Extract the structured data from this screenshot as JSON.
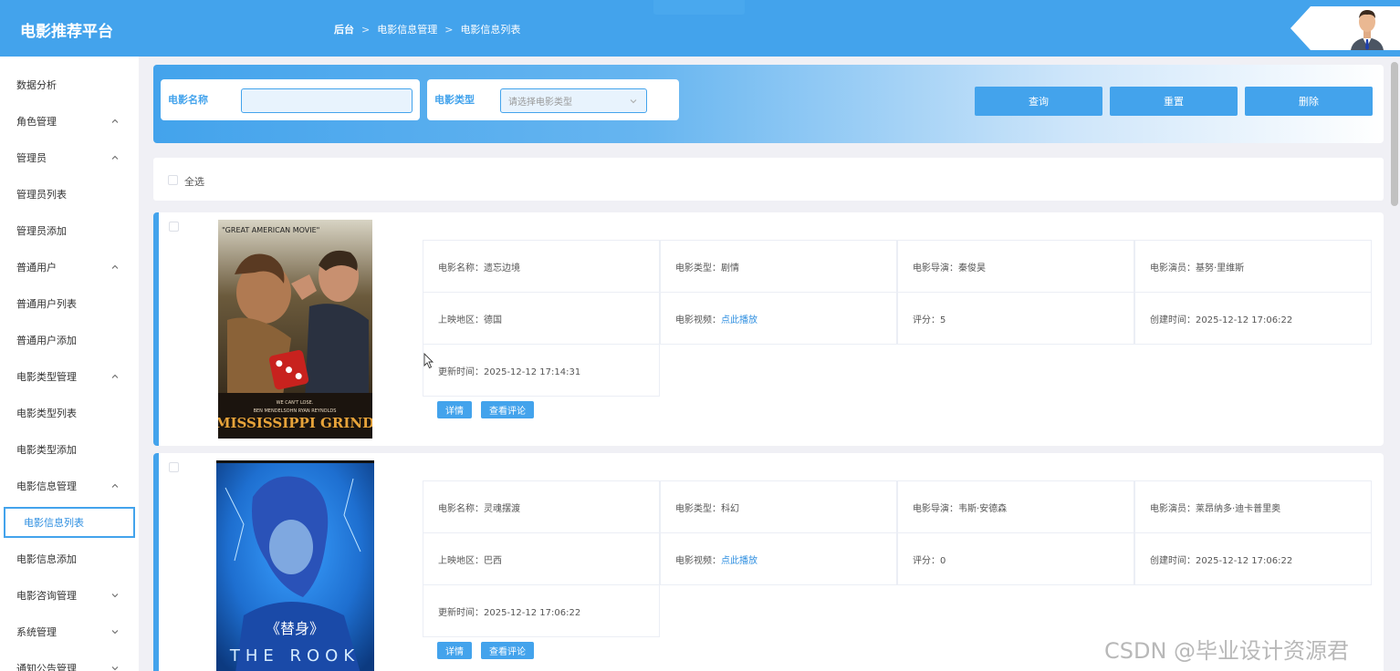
{
  "header": {
    "brand": "电影推荐平台",
    "breadcrumb": [
      "后台",
      "电影信息管理",
      "电影信息列表"
    ]
  },
  "sidebar": {
    "items": [
      {
        "label": "数据分析",
        "chevron": "none"
      },
      {
        "label": "角色管理",
        "chevron": "up"
      },
      {
        "label": "管理员",
        "chevron": "up"
      },
      {
        "label": "管理员列表",
        "chevron": "none"
      },
      {
        "label": "管理员添加",
        "chevron": "none"
      },
      {
        "label": "普通用户",
        "chevron": "up"
      },
      {
        "label": "普通用户列表",
        "chevron": "none"
      },
      {
        "label": "普通用户添加",
        "chevron": "none"
      },
      {
        "label": "电影类型管理",
        "chevron": "up"
      },
      {
        "label": "电影类型列表",
        "chevron": "none"
      },
      {
        "label": "电影类型添加",
        "chevron": "none"
      },
      {
        "label": "电影信息管理",
        "chevron": "up"
      },
      {
        "label": "电影信息列表",
        "chevron": "none",
        "active": true
      },
      {
        "label": "电影信息添加",
        "chevron": "none"
      },
      {
        "label": "电影咨询管理",
        "chevron": "down"
      },
      {
        "label": "系统管理",
        "chevron": "down"
      },
      {
        "label": "通知公告管理",
        "chevron": "down"
      }
    ]
  },
  "search": {
    "name_label": "电影名称",
    "name_value": "",
    "type_label": "电影类型",
    "type_placeholder": "请选择电影类型",
    "query_button": "查询",
    "reset_button": "重置",
    "delete_button": "删除"
  },
  "list": {
    "select_all_label": "全选",
    "detail_button": "详情",
    "comment_button": "查看评论",
    "movies": [
      {
        "poster_texts": [
          "\"GREAT AMERICAN MOVIE\"",
          "WE CAN'T LOSE.",
          "BEN MENDELSOHN   RYAN REYNOLDS",
          "MISSISSIPPI GRIND"
        ],
        "name": "电影名称：遗忘边境",
        "type": "电影类型：剧情",
        "director": "电影导演：秦俊昊",
        "actor": "电影演员：基努·里维斯",
        "region": "上映地区：德国",
        "video_label": "电影视频：",
        "video_link": "点此播放",
        "score": "评分：5",
        "created": "创建时间：2025-12-12 17:06:22",
        "updated": "更新时间：2025-12-12 17:14:31"
      },
      {
        "poster_texts": [
          "《替身》",
          "THE ROOK"
        ],
        "name": "电影名称：灵魂摆渡",
        "type": "电影类型：科幻",
        "director": "电影导演：韦斯·安德森",
        "actor": "电影演员：莱昂纳多·迪卡普里奥",
        "region": "上映地区：巴西",
        "video_label": "电影视频：",
        "video_link": "点此播放",
        "score": "评分：0",
        "created": "创建时间：2025-12-12 17:06:22",
        "updated": "更新时间：2025-12-12 17:06:22"
      }
    ]
  },
  "watermark": "CSDN @毕业设计资源君",
  "colors": {
    "accent": "#43a3ec",
    "link": "#2f8fe0",
    "background": "#f0f0f5"
  }
}
